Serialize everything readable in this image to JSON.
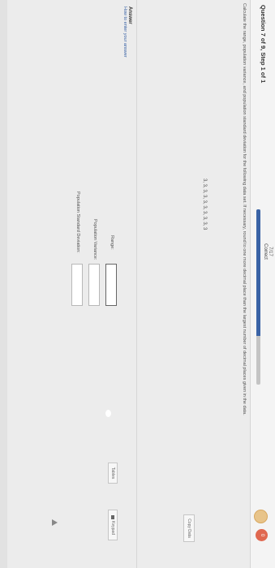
{
  "header": {
    "question_title": "Question 7 of 9, Step 1 of 1",
    "score_fraction": "7/17",
    "status": "Correct",
    "progress_fraction": 0.72,
    "nav_badge": "0"
  },
  "problem": {
    "instructions": "Calculate the range, population variance, and population standard deviation for the following data set. If necessary, round to one more decimal place than the largest number of decimal places given in the data.",
    "dataset": "3, 3, 3, 3, 3, 3, 3, 3, 3, 3",
    "copy_label": "Copy Data"
  },
  "answer": {
    "heading": "Answer",
    "help_link": "How to enter your answer",
    "fields": [
      {
        "label": "Range:",
        "value": ""
      },
      {
        "label": "Population Variance:",
        "value": ""
      },
      {
        "label": "Population Standard Deviation:",
        "value": ""
      }
    ],
    "tables_label": "Tables",
    "keypad_label": "Keypad"
  },
  "colors": {
    "accent": "#3a63a6",
    "badge": "#e06850"
  }
}
